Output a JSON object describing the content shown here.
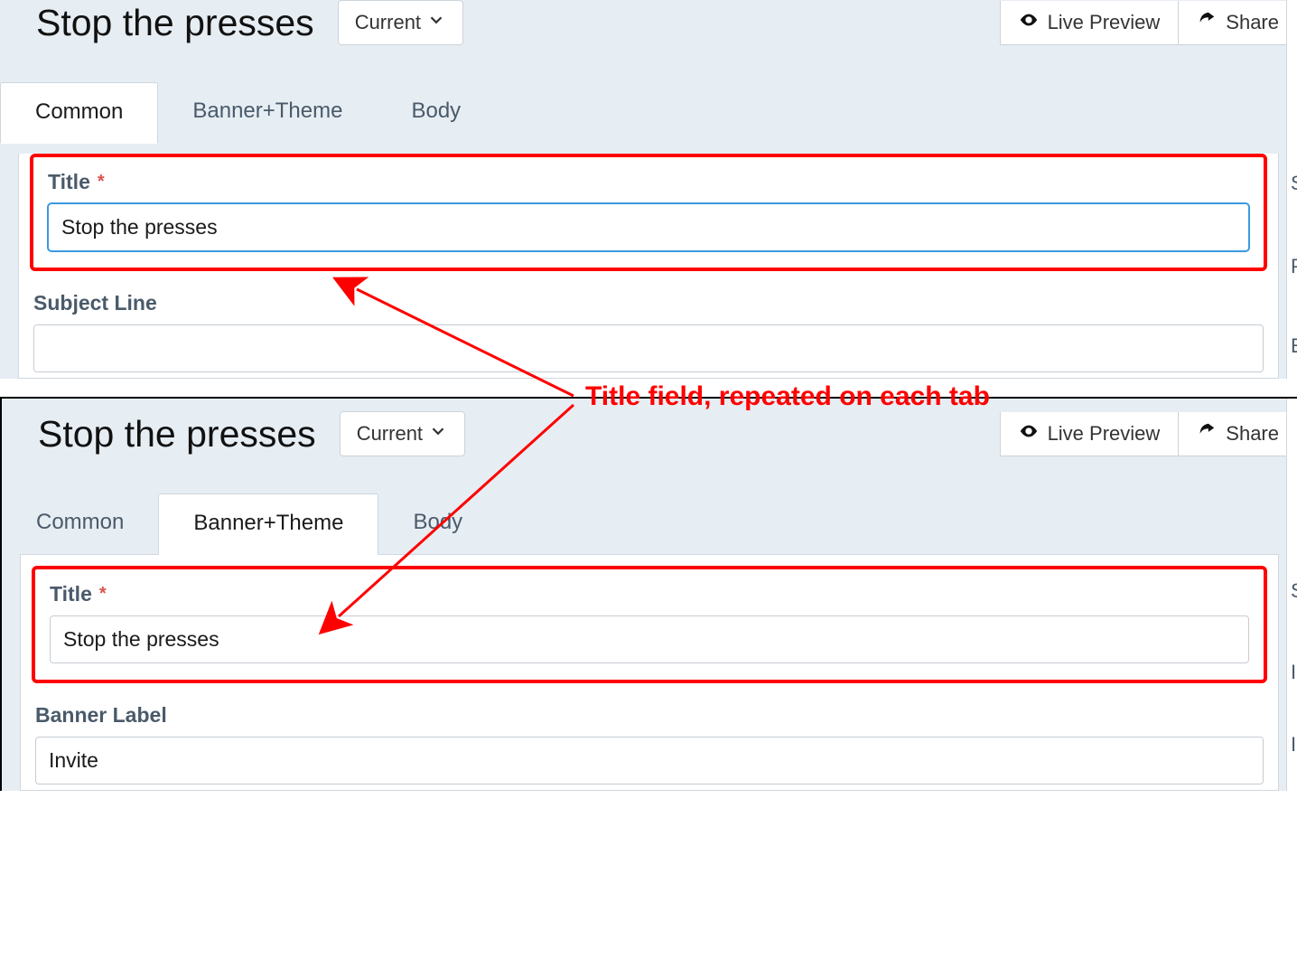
{
  "annotation": {
    "callout": "Title field, repeated on each tab"
  },
  "panel1": {
    "title": "Stop the presses",
    "version_label": "Current",
    "live_preview": "Live Preview",
    "share": "Share",
    "tabs": {
      "common": "Common",
      "banner": "Banner+Theme",
      "body": "Body"
    },
    "fields": {
      "title_label": "Title",
      "title_value": "Stop the presses",
      "subject_label": "Subject Line",
      "subject_value": ""
    }
  },
  "panel2": {
    "title": "Stop the presses",
    "version_label": "Current",
    "live_preview": "Live Preview",
    "share": "Share",
    "tabs": {
      "common": "Common",
      "banner": "Banner+Theme",
      "body": "Body"
    },
    "fields": {
      "title_label": "Title",
      "title_value": "Stop the presses",
      "banner_label": "Banner Label",
      "banner_value": "Invite"
    }
  }
}
